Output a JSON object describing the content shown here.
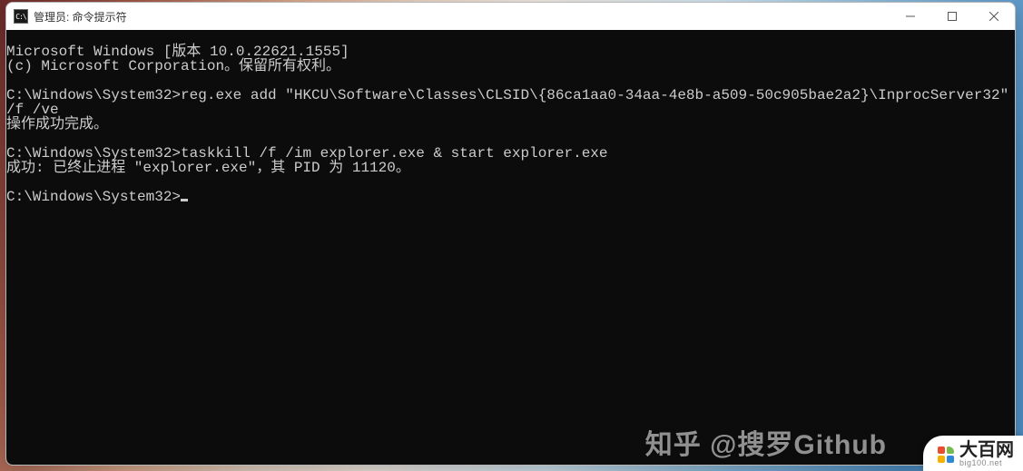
{
  "titlebar": {
    "icon_glyph": "C:\\",
    "title": "管理员: 命令提示符"
  },
  "terminal": {
    "banner_version": "Microsoft Windows [版本 10.0.22621.1555]",
    "banner_copyright": "(c) Microsoft Corporation。保留所有权利。",
    "prompt": "C:\\Windows\\System32>",
    "entries": [
      {
        "cmd": "reg.exe add \"HKCU\\Software\\Classes\\CLSID\\{86ca1aa0-34aa-4e8b-a509-50c905bae2a2}\\InprocServer32\" /f /ve",
        "output": "操作成功完成。"
      },
      {
        "cmd": "taskkill /f /im explorer.exe & start explorer.exe",
        "output": "成功: 已终止进程 \"explorer.exe\"，其 PID 为 11120。"
      }
    ]
  },
  "watermark": {
    "zhihu": "知乎 @搜罗Github",
    "dabai_cn": "大百网",
    "dabai_en": "big100.net"
  }
}
